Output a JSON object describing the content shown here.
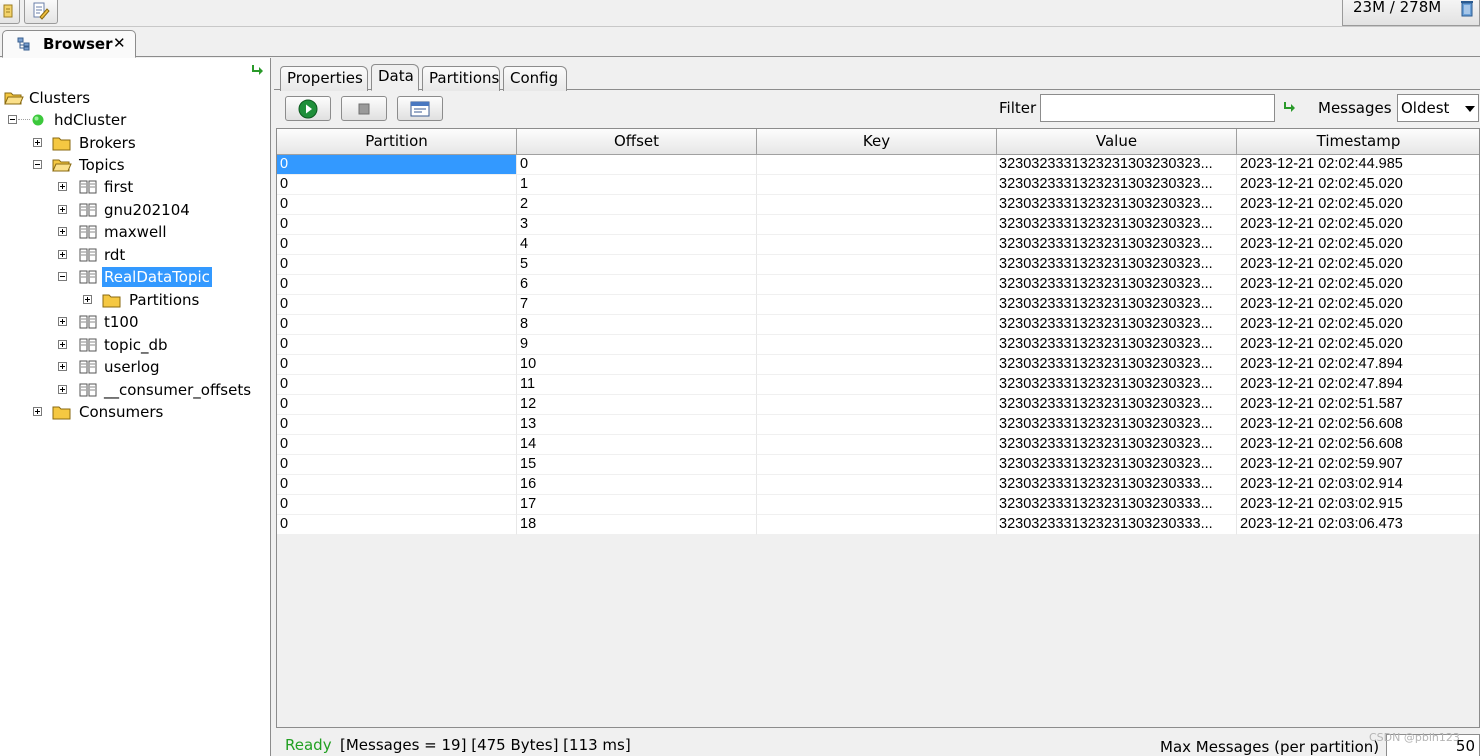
{
  "toolbar": {
    "memory": "23M / 278M",
    "icons": [
      "new-connection-icon",
      "edit-connection-icon",
      "trash-icon"
    ]
  },
  "view_tab": {
    "label": "Browser",
    "close": "✕"
  },
  "tree": {
    "root": "Clusters",
    "cluster": "hdCluster",
    "brokers": "Brokers",
    "topics": "Topics",
    "topic_items": [
      "first",
      "gnu202104",
      "maxwell",
      "rdt",
      "RealDataTopic",
      "t100",
      "topic_db",
      "userlog",
      "__consumer_offsets"
    ],
    "partitions": "Partitions",
    "consumers": "Consumers",
    "selected": "RealDataTopic"
  },
  "subtabs": [
    "Properties",
    "Data",
    "Partitions",
    "Config"
  ],
  "active_subtab": "Data",
  "data_toolbar": {
    "filter_label": "Filter",
    "filter_value": "",
    "messages_label": "Messages",
    "messages_value": "Oldest"
  },
  "table": {
    "columns": [
      "Partition",
      "Offset",
      "Key",
      "Value",
      "Timestamp"
    ],
    "rows": [
      {
        "partition": "0",
        "offset": "0",
        "key": "",
        "value": "3230323331323231303230323...",
        "timestamp": "2023-12-21 02:02:44.985"
      },
      {
        "partition": "0",
        "offset": "1",
        "key": "",
        "value": "3230323331323231303230323...",
        "timestamp": "2023-12-21 02:02:45.020"
      },
      {
        "partition": "0",
        "offset": "2",
        "key": "",
        "value": "3230323331323231303230323...",
        "timestamp": "2023-12-21 02:02:45.020"
      },
      {
        "partition": "0",
        "offset": "3",
        "key": "",
        "value": "3230323331323231303230323...",
        "timestamp": "2023-12-21 02:02:45.020"
      },
      {
        "partition": "0",
        "offset": "4",
        "key": "",
        "value": "3230323331323231303230323...",
        "timestamp": "2023-12-21 02:02:45.020"
      },
      {
        "partition": "0",
        "offset": "5",
        "key": "",
        "value": "3230323331323231303230323...",
        "timestamp": "2023-12-21 02:02:45.020"
      },
      {
        "partition": "0",
        "offset": "6",
        "key": "",
        "value": "3230323331323231303230323...",
        "timestamp": "2023-12-21 02:02:45.020"
      },
      {
        "partition": "0",
        "offset": "7",
        "key": "",
        "value": "3230323331323231303230323...",
        "timestamp": "2023-12-21 02:02:45.020"
      },
      {
        "partition": "0",
        "offset": "8",
        "key": "",
        "value": "3230323331323231303230323...",
        "timestamp": "2023-12-21 02:02:45.020"
      },
      {
        "partition": "0",
        "offset": "9",
        "key": "",
        "value": "3230323331323231303230323...",
        "timestamp": "2023-12-21 02:02:45.020"
      },
      {
        "partition": "0",
        "offset": "10",
        "key": "",
        "value": "3230323331323231303230323...",
        "timestamp": "2023-12-21 02:02:47.894"
      },
      {
        "partition": "0",
        "offset": "11",
        "key": "",
        "value": "3230323331323231303230323...",
        "timestamp": "2023-12-21 02:02:47.894"
      },
      {
        "partition": "0",
        "offset": "12",
        "key": "",
        "value": "3230323331323231303230323...",
        "timestamp": "2023-12-21 02:02:51.587"
      },
      {
        "partition": "0",
        "offset": "13",
        "key": "",
        "value": "3230323331323231303230323...",
        "timestamp": "2023-12-21 02:02:56.608"
      },
      {
        "partition": "0",
        "offset": "14",
        "key": "",
        "value": "3230323331323231303230323...",
        "timestamp": "2023-12-21 02:02:56.608"
      },
      {
        "partition": "0",
        "offset": "15",
        "key": "",
        "value": "3230323331323231303230323...",
        "timestamp": "2023-12-21 02:02:59.907"
      },
      {
        "partition": "0",
        "offset": "16",
        "key": "",
        "value": "3230323331323231303230333...",
        "timestamp": "2023-12-21 02:03:02.914"
      },
      {
        "partition": "0",
        "offset": "17",
        "key": "",
        "value": "3230323331323231303230333...",
        "timestamp": "2023-12-21 02:03:02.915"
      },
      {
        "partition": "0",
        "offset": "18",
        "key": "",
        "value": "3230323331323231303230333...",
        "timestamp": "2023-12-21 02:03:06.473"
      }
    ]
  },
  "status": {
    "ready": "Ready",
    "info": "[Messages = 19]  [475 Bytes]  [113 ms]",
    "max_label": "Max Messages (per partition)",
    "max_value": "50"
  },
  "watermark": "CSDN @pblh123",
  "colors": {
    "selection": "#3399ff",
    "ready": "#22a022",
    "cluster_dot": "#3cc83c",
    "folder": "#f5c842"
  }
}
